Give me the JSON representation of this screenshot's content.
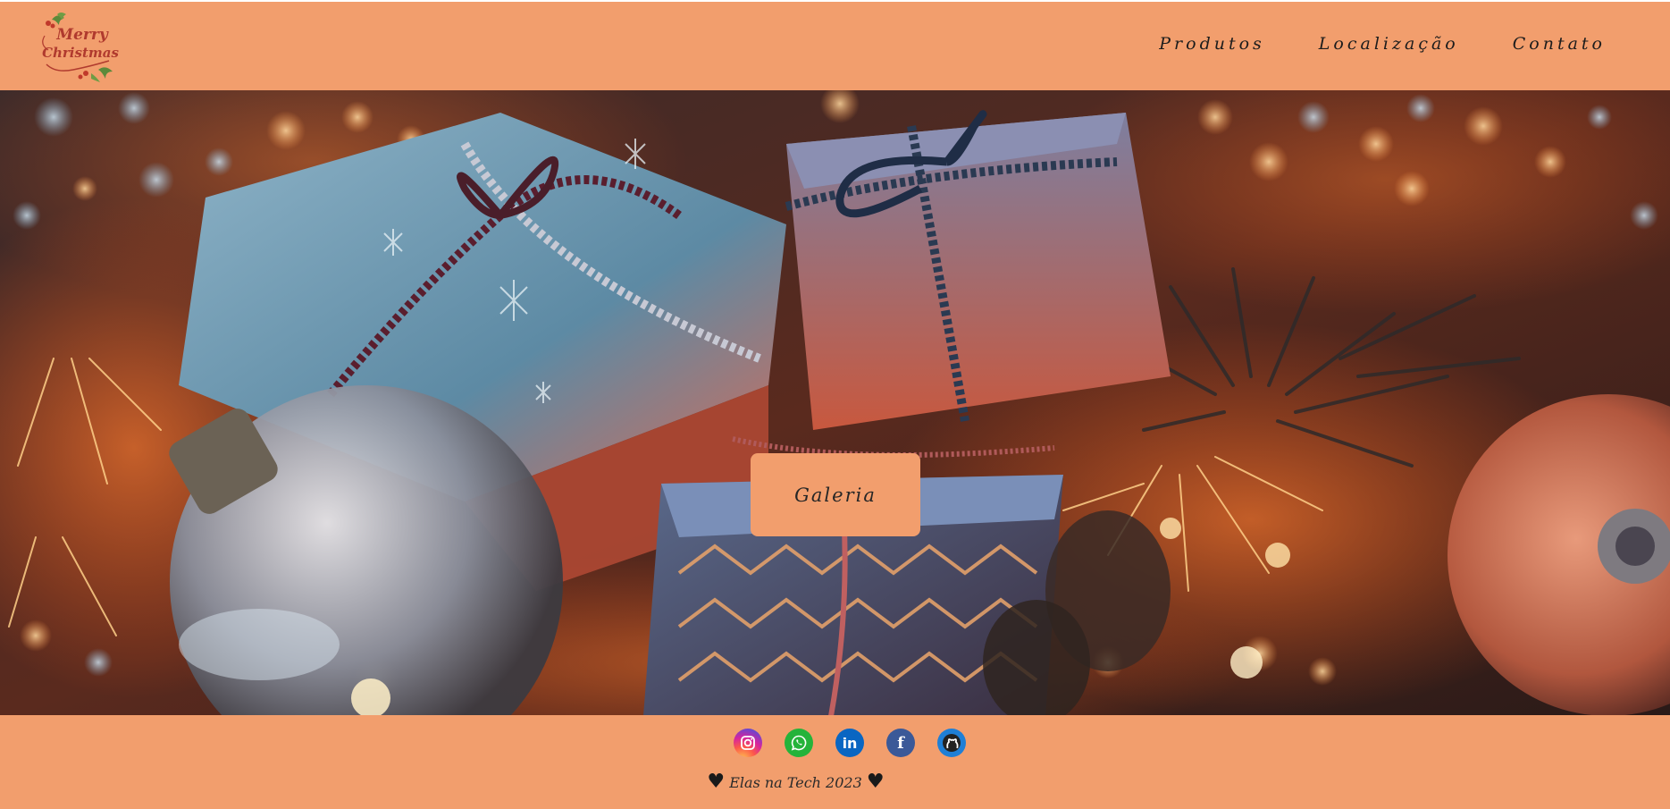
{
  "header": {
    "logo_line1": "Merry",
    "logo_line2": "Christmas",
    "nav": [
      {
        "label": "Produtos"
      },
      {
        "label": "Localização"
      },
      {
        "label": "Contato"
      }
    ]
  },
  "hero": {
    "button_label": "Galeria"
  },
  "footer": {
    "socials": [
      {
        "icon": "instagram-icon",
        "color": "#d6249f"
      },
      {
        "icon": "whatsapp-icon",
        "color": "#25b33a"
      },
      {
        "icon": "linkedin-icon",
        "color": "#0a66c2",
        "text": "in"
      },
      {
        "icon": "facebook-icon",
        "color": "#3b5998",
        "text": "f"
      },
      {
        "icon": "github-icon",
        "color": "#1f7fd6"
      }
    ],
    "heart": "♥",
    "copyright": "Elas na Tech 2023"
  },
  "colors": {
    "accent": "#F29E6D",
    "text": "#1c1c1c"
  }
}
